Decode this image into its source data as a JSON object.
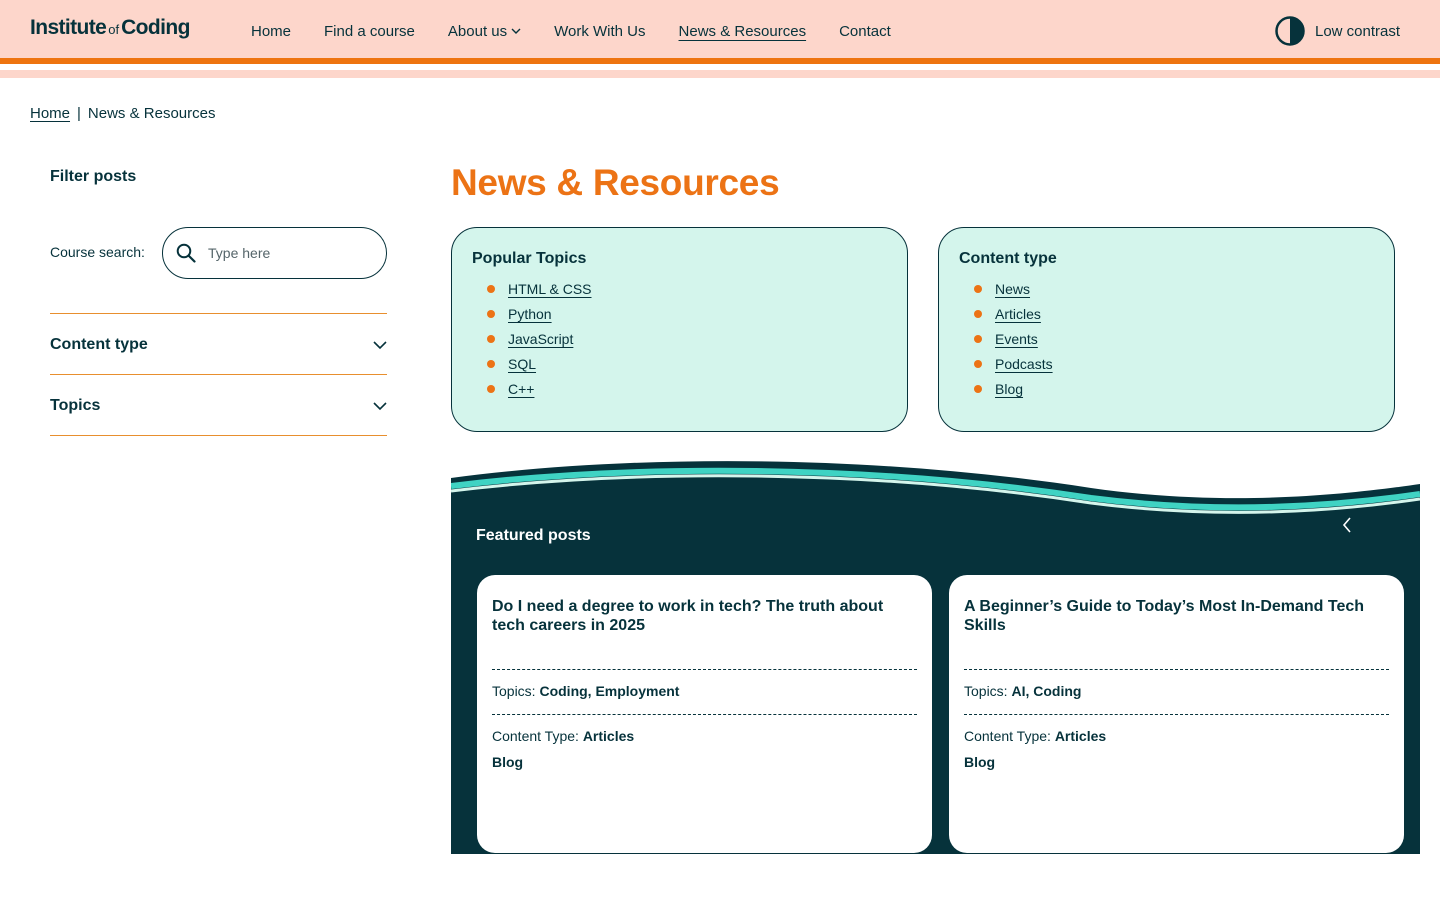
{
  "header": {
    "logo_main": "Institute",
    "logo_of": "of",
    "logo_end": "Coding",
    "nav": [
      {
        "label": "Home"
      },
      {
        "label": "Find a course"
      },
      {
        "label": "About us"
      },
      {
        "label": "Work With Us"
      },
      {
        "label": "News & Resources"
      },
      {
        "label": "Contact"
      }
    ],
    "contrast_label": "Low contrast"
  },
  "breadcrumb": {
    "home": "Home",
    "separator": "|",
    "current": "News & Resources"
  },
  "sidebar": {
    "filter_title": "Filter posts",
    "search_label": "Course search:",
    "search_placeholder": "Type here",
    "accordions": [
      {
        "label": "Content type"
      },
      {
        "label": "Topics"
      }
    ]
  },
  "main": {
    "title": "News & Resources",
    "popular_topics": {
      "title": "Popular Topics",
      "items": [
        "HTML & CSS",
        "Python",
        "JavaScript",
        "SQL",
        "C++"
      ]
    },
    "content_type": {
      "title": "Content type",
      "items": [
        "News",
        "Articles",
        "Events",
        "Podcasts",
        "Blog"
      ]
    },
    "featured": {
      "title": "Featured posts",
      "posts": [
        {
          "title": "Do I need a degree to work in tech? The truth about tech careers in 2025",
          "topics_label": "Topics:",
          "topics": "Coding, Employment",
          "content_type_label": "Content Type:",
          "content_type": "Articles",
          "extra": "Blog"
        },
        {
          "title": "A Beginner’s Guide to Today’s Most In-Demand Tech Skills",
          "topics_label": "Topics:",
          "topics": "AI, Coding",
          "content_type_label": "Content Type:",
          "content_type": "Articles",
          "extra": "Blog"
        }
      ]
    }
  },
  "colors": {
    "brand_dark": "#06323b",
    "accent_orange": "#ec7315",
    "header_peach": "#fdd6cb",
    "card_mint": "#d4f5ec",
    "wave_teal": "#3fd3c3"
  },
  "icons": [
    "search-icon",
    "chevron-down-icon",
    "contrast-icon",
    "chevron-left-icon"
  ]
}
